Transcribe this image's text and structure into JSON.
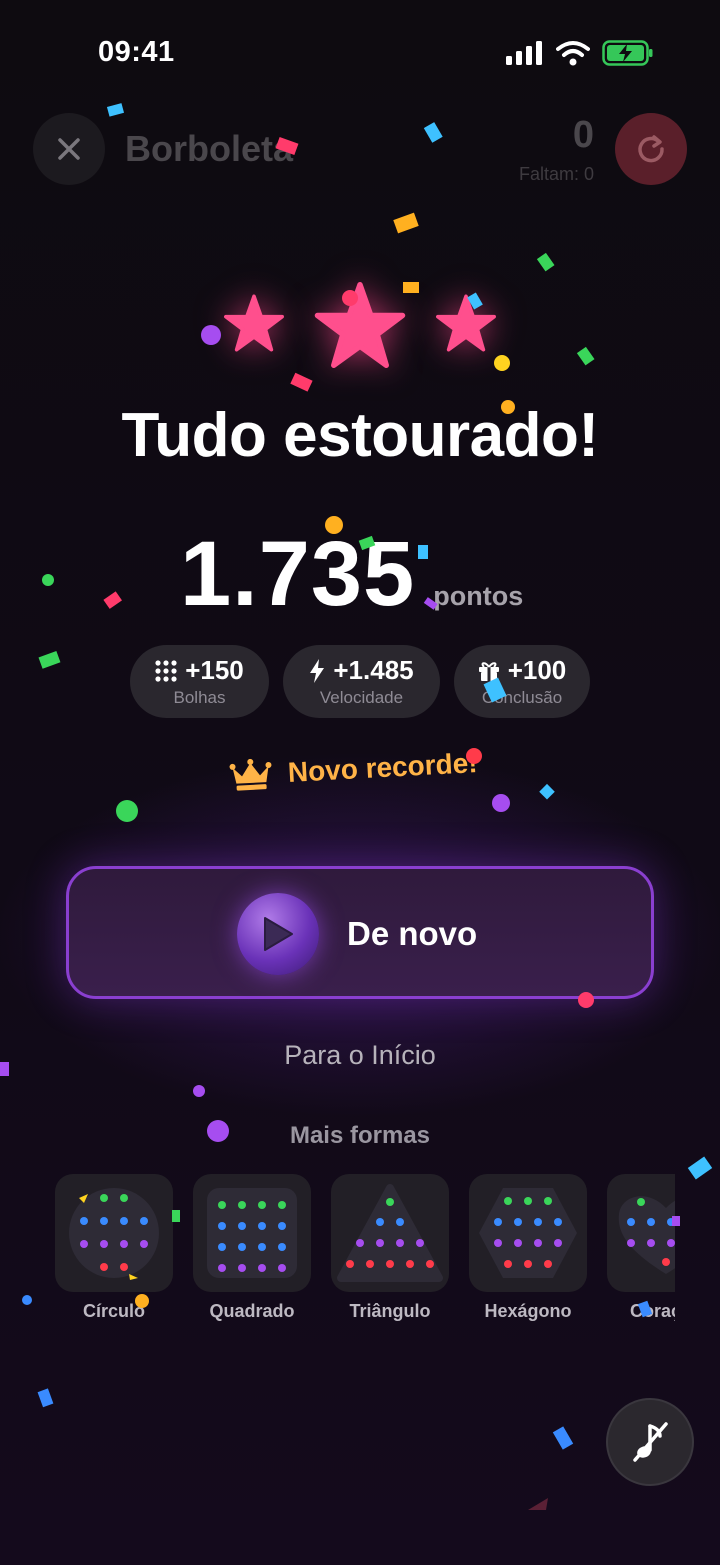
{
  "status_bar": {
    "time": "09:41"
  },
  "header": {
    "title": "Borboleta",
    "score": "0",
    "remaining": "Faltam: 0"
  },
  "result": {
    "stars_earned": 3,
    "title": "Tudo estourado!",
    "points": "1.735",
    "points_label": "pontos",
    "breakdown": [
      {
        "icon": "bubbles-grid-icon",
        "value": "+150",
        "label": "Bolhas"
      },
      {
        "icon": "lightning-icon",
        "value": "+1.485",
        "label": "Velocidade"
      },
      {
        "icon": "gift-icon",
        "value": "+100",
        "label": "Conclusão"
      }
    ],
    "record_text": "Novo recorde!"
  },
  "actions": {
    "play_again": "De novo",
    "home": "Para o Início"
  },
  "more_shapes": {
    "title": "Mais formas",
    "items": [
      {
        "label": "Círculo"
      },
      {
        "label": "Quadrado"
      },
      {
        "label": "Triângulo"
      },
      {
        "label": "Hexágono"
      },
      {
        "label": "Coração"
      }
    ]
  },
  "colors": {
    "star": "#ff4f8d",
    "accent_purple": "#8a3fd0",
    "record": "#ffb347",
    "restart_bg": "#5a1f2a",
    "dot_green": "#3ad65a",
    "dot_blue": "#3a8bff",
    "dot_purple": "#a64df0",
    "dot_red": "#ff3b4a"
  }
}
